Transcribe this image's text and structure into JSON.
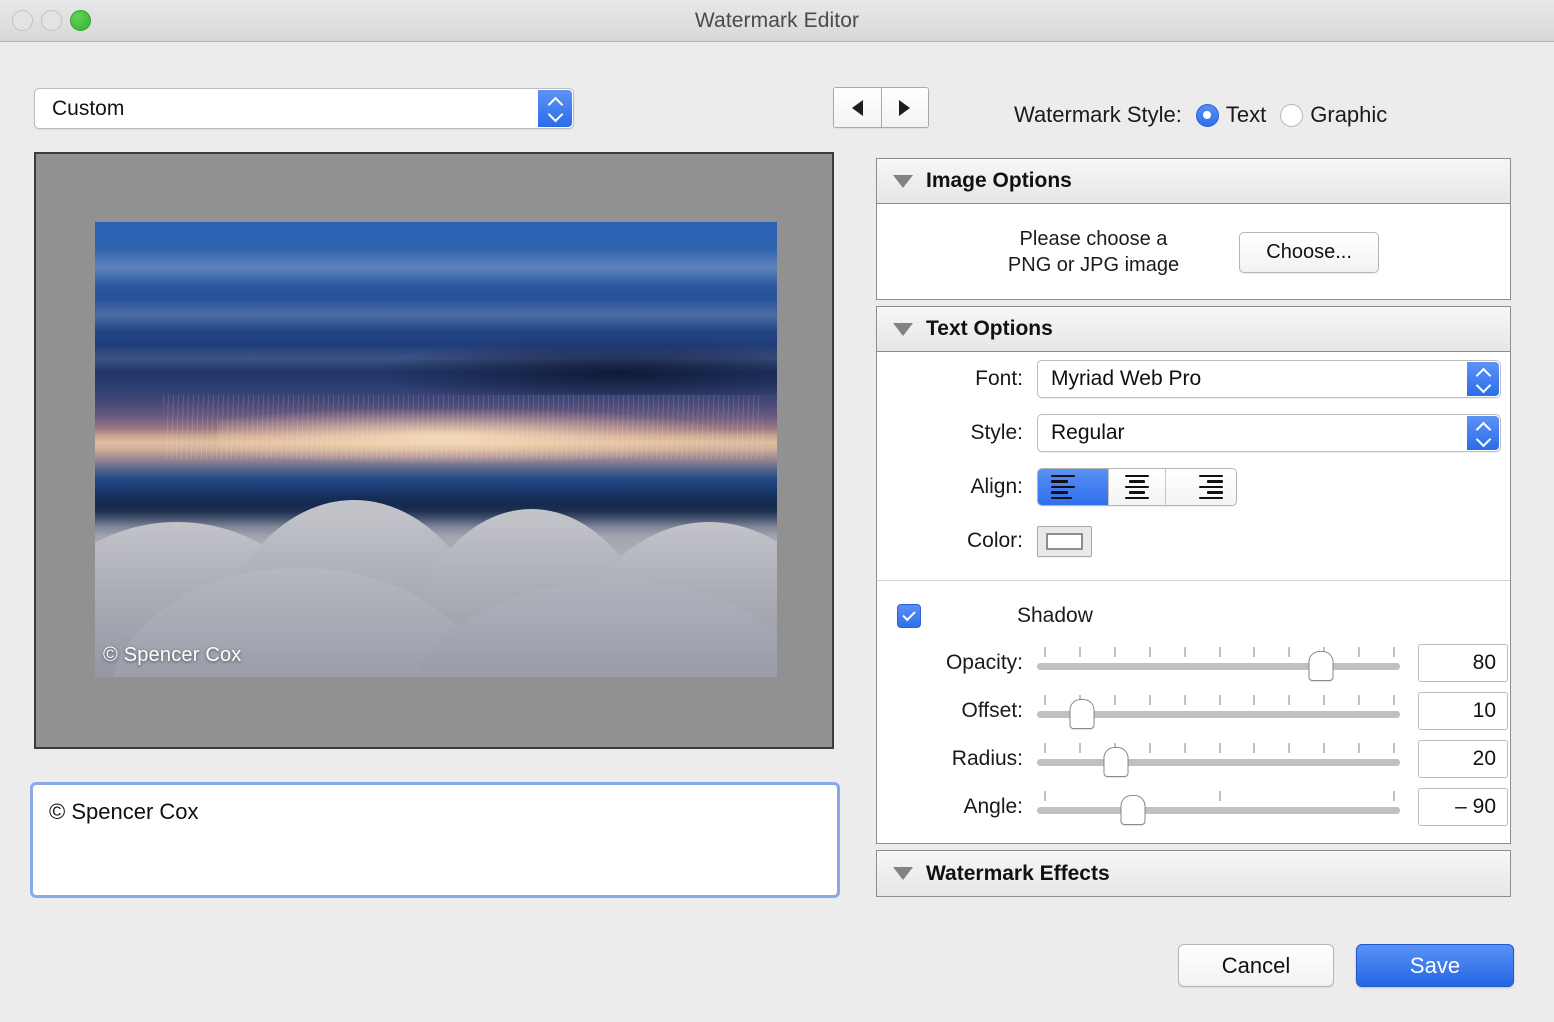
{
  "window": {
    "title": "Watermark Editor",
    "traffic_lights": [
      "close",
      "minimize",
      "zoom"
    ]
  },
  "preset": {
    "value": "Custom"
  },
  "nav": {
    "prev_icon": "triangle-left-icon",
    "next_icon": "triangle-right-icon"
  },
  "watermark_style": {
    "label": "Watermark Style:",
    "options": [
      "Text",
      "Graphic"
    ],
    "selected": "Text"
  },
  "preview": {
    "watermark_text": "© Spencer Cox"
  },
  "watermark_text_input": {
    "value": "© Spencer Cox"
  },
  "image_options": {
    "title": "Image Options",
    "message": "Please choose a\nPNG or JPG image",
    "message_line1": "Please choose a",
    "message_line2": "PNG or JPG image",
    "choose_label": "Choose..."
  },
  "text_options": {
    "title": "Text Options",
    "font": {
      "label": "Font:",
      "value": "Myriad Web Pro"
    },
    "style": {
      "label": "Style:",
      "value": "Regular"
    },
    "align": {
      "label": "Align:",
      "options": [
        "left",
        "center",
        "right"
      ],
      "selected": "left"
    },
    "color": {
      "label": "Color:",
      "value": "#ffffff"
    },
    "shadow": {
      "label": "Shadow",
      "enabled": true,
      "sliders": [
        {
          "label": "Opacity:",
          "value": "80",
          "percent": 80,
          "ticks": 11
        },
        {
          "label": "Offset:",
          "value": "10",
          "percent": 10,
          "ticks": 11
        },
        {
          "label": "Radius:",
          "value": "20",
          "percent": 20,
          "ticks": 11
        },
        {
          "label": "Angle:",
          "value": "– 90",
          "percent": 25,
          "ticks": 3
        }
      ]
    }
  },
  "watermark_effects": {
    "title": "Watermark Effects"
  },
  "footer": {
    "cancel_label": "Cancel",
    "save_label": "Save"
  },
  "colors": {
    "accent": "#2f6fec",
    "window_bg": "#ececec",
    "matte": "#919191"
  }
}
